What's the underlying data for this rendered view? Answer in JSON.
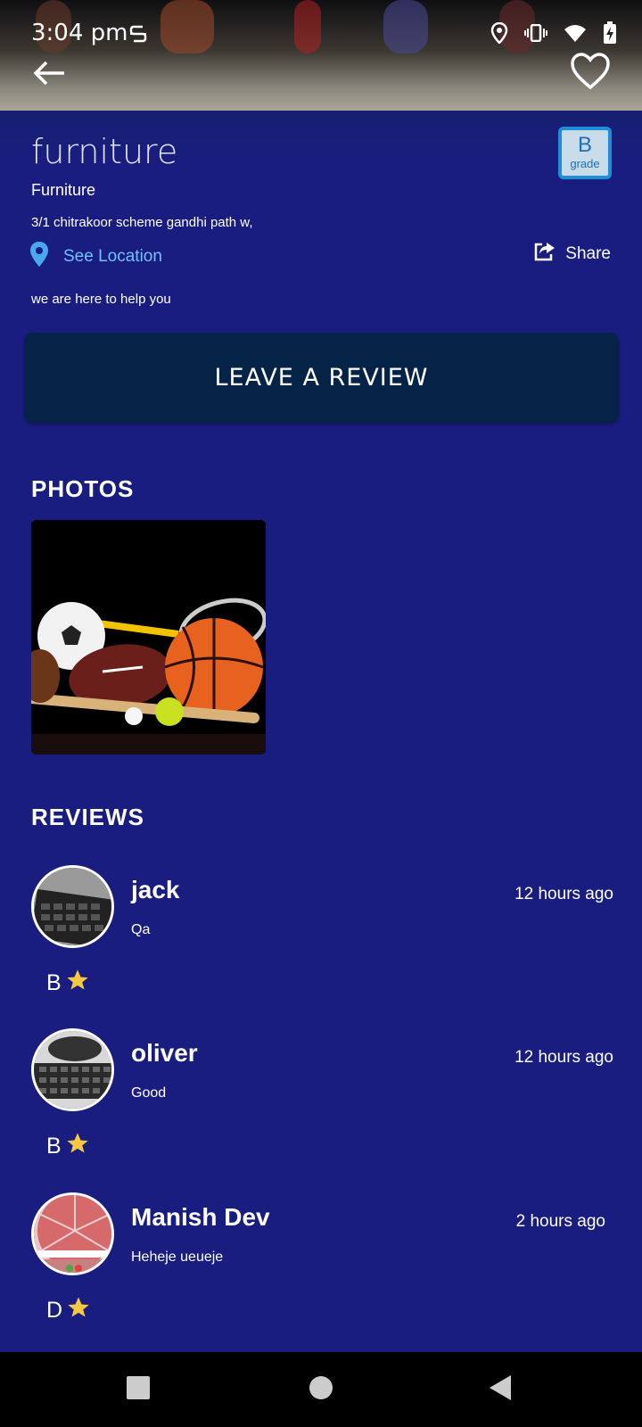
{
  "status_bar": {
    "time": "3:04 pm",
    "icons": [
      "screenshot-icon",
      "location-icon",
      "vibrate-icon",
      "wifi-icon",
      "battery-charging-icon"
    ]
  },
  "header": {
    "back_icon": "back-arrow-icon",
    "favorite_icon": "heart-icon"
  },
  "business": {
    "title": "furniture",
    "grade_letter": "B",
    "grade_word": "grade",
    "category": "Furniture",
    "address": "3/1 chitrakoor scheme gandhi path w,",
    "see_location": "See Location",
    "share": "Share",
    "tagline": "we are here to help you"
  },
  "actions": {
    "leave_review": "LEAVE A REVIEW"
  },
  "photos": {
    "title": "PHOTOS",
    "items": [
      "sports-equipment-photo"
    ]
  },
  "reviews": {
    "title": "REVIEWS",
    "items": [
      {
        "name": "jack",
        "time": "12 hours ago",
        "comment": "Qa",
        "grade": "B"
      },
      {
        "name": "oliver",
        "time": "12 hours ago",
        "comment": "Good",
        "grade": "B"
      },
      {
        "name": "Manish Dev",
        "time": "2 hours ago",
        "comment": "Heheje ueueje",
        "grade": "D"
      }
    ]
  },
  "nav": {
    "icons": [
      "recents-square-icon",
      "home-circle-icon",
      "back-triangle-icon"
    ]
  },
  "colors": {
    "background": "#1a1d80",
    "button": "#052247",
    "link": "#6fc1ff",
    "star": "#f5c842",
    "badge_border": "#1f8ed8"
  }
}
